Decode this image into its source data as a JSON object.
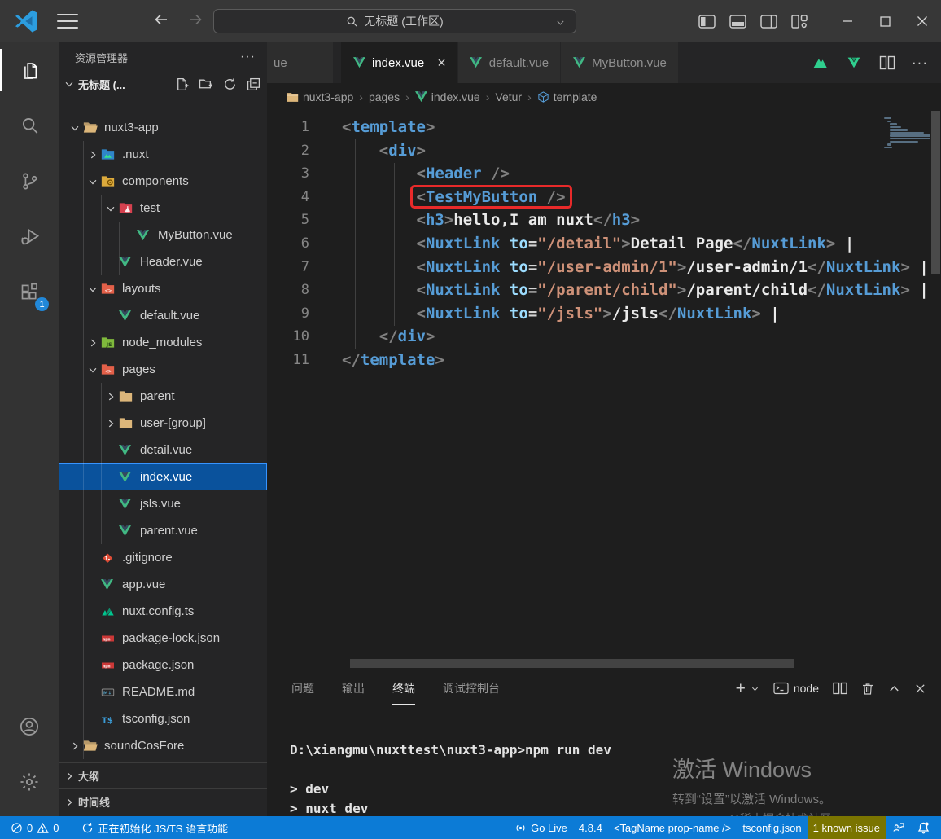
{
  "window": {
    "search_label": "无标题 (工作区)"
  },
  "activity_bar": {
    "extensions_badge": "1"
  },
  "sidebar": {
    "title": "资源管理器",
    "more_actions": "···",
    "section_label": "无标题 (...",
    "tree": [
      {
        "label": "nuxt3-app",
        "icon": "folder-open",
        "color": "#dcb67a",
        "level": 0,
        "chevron": "down"
      },
      {
        "label": ".nuxt",
        "icon": "folder-nuxt",
        "color": "#2f86c9",
        "level": 1,
        "chevron": "right"
      },
      {
        "label": "components",
        "icon": "folder-components",
        "color": "#dcaa3c",
        "level": 1,
        "chevron": "down"
      },
      {
        "label": "test",
        "icon": "folder-test",
        "color": "#d6414f",
        "level": 2,
        "chevron": "down"
      },
      {
        "label": "MyButton.vue",
        "icon": "vue",
        "level": 3
      },
      {
        "label": "Header.vue",
        "icon": "vue",
        "level": 2
      },
      {
        "label": "layouts",
        "icon": "folder-code",
        "color": "#e36049",
        "level": 1,
        "chevron": "down"
      },
      {
        "label": "default.vue",
        "icon": "vue",
        "level": 2
      },
      {
        "label": "node_modules",
        "icon": "folder-node",
        "color": "#7fb93c",
        "level": 1,
        "chevron": "right"
      },
      {
        "label": "pages",
        "icon": "folder-code",
        "color": "#e36049",
        "level": 1,
        "chevron": "down"
      },
      {
        "label": "parent",
        "icon": "folder",
        "color": "#dcb67a",
        "level": 2,
        "chevron": "right"
      },
      {
        "label": "user-[group]",
        "icon": "folder",
        "color": "#dcb67a",
        "level": 2,
        "chevron": "right"
      },
      {
        "label": "detail.vue",
        "icon": "vue",
        "level": 2
      },
      {
        "label": "index.vue",
        "icon": "vue",
        "level": 2,
        "selected": true
      },
      {
        "label": "jsls.vue",
        "icon": "vue",
        "level": 2
      },
      {
        "label": "parent.vue",
        "icon": "vue",
        "level": 2
      },
      {
        "label": ".gitignore",
        "icon": "git",
        "level": 1
      },
      {
        "label": "app.vue",
        "icon": "vue",
        "level": 1
      },
      {
        "label": "nuxt.config.ts",
        "icon": "nuxt",
        "level": 1
      },
      {
        "label": "package-lock.json",
        "icon": "npm",
        "level": 1
      },
      {
        "label": "package.json",
        "icon": "npm",
        "level": 1
      },
      {
        "label": "README.md",
        "icon": "md",
        "level": 1
      },
      {
        "label": "tsconfig.json",
        "icon": "ts",
        "level": 1
      },
      {
        "label": "soundCosFore",
        "icon": "folder-open",
        "color": "#dcb67a",
        "level": 0,
        "chevron": "right"
      }
    ],
    "bottom_sections": [
      {
        "label": "大纲"
      },
      {
        "label": "时间线"
      }
    ]
  },
  "editor": {
    "tabs": [
      {
        "label": "ue",
        "partial": true
      },
      {
        "label": "index.vue",
        "active": true
      },
      {
        "label": "default.vue"
      },
      {
        "label": "MyButton.vue"
      }
    ],
    "breadcrumb": [
      {
        "label": "nuxt3-app",
        "icon": "folder-sm"
      },
      {
        "label": "pages"
      },
      {
        "label": "index.vue",
        "icon": "vue"
      },
      {
        "label": "Vetur"
      },
      {
        "label": "template",
        "icon": "symbol"
      }
    ],
    "code_lines": [
      {
        "num": "1",
        "indent": 0,
        "segments": [
          {
            "t": "<",
            "c": "punct"
          },
          {
            "t": "template",
            "c": "tag"
          },
          {
            "t": ">",
            "c": "punct"
          }
        ]
      },
      {
        "num": "2",
        "indent": 1,
        "segments": [
          {
            "t": "<",
            "c": "punct"
          },
          {
            "t": "div",
            "c": "tag"
          },
          {
            "t": ">",
            "c": "punct"
          }
        ]
      },
      {
        "num": "3",
        "indent": 2,
        "segments": [
          {
            "t": "<",
            "c": "punct"
          },
          {
            "t": "Header",
            "c": "tag"
          },
          {
            "t": " />",
            "c": "punct"
          }
        ]
      },
      {
        "num": "4",
        "indent": 2,
        "boxed": true,
        "segments": [
          {
            "t": "<",
            "c": "punct"
          },
          {
            "t": "TestMyButton",
            "c": "tag"
          },
          {
            "t": " />",
            "c": "punct"
          }
        ]
      },
      {
        "num": "5",
        "indent": 2,
        "segments": [
          {
            "t": "<",
            "c": "punct"
          },
          {
            "t": "h3",
            "c": "tag"
          },
          {
            "t": ">",
            "c": "punct"
          },
          {
            "t": "hello,I am nuxt",
            "c": "text"
          },
          {
            "t": "</",
            "c": "punct"
          },
          {
            "t": "h3",
            "c": "tag"
          },
          {
            "t": ">",
            "c": "punct"
          }
        ]
      },
      {
        "num": "6",
        "indent": 2,
        "segments": [
          {
            "t": "<",
            "c": "punct"
          },
          {
            "t": "NuxtLink",
            "c": "tag"
          },
          {
            "t": " ",
            "c": "punct"
          },
          {
            "t": "to",
            "c": "attr"
          },
          {
            "t": "=",
            "c": "op"
          },
          {
            "t": "\"/detail\"",
            "c": "str"
          },
          {
            "t": ">",
            "c": "punct"
          },
          {
            "t": "Detail Page",
            "c": "text"
          },
          {
            "t": "</",
            "c": "punct"
          },
          {
            "t": "NuxtLink",
            "c": "tag"
          },
          {
            "t": ">",
            "c": "punct"
          },
          {
            "t": " |",
            "c": "text"
          }
        ]
      },
      {
        "num": "7",
        "indent": 2,
        "segments": [
          {
            "t": "<",
            "c": "punct"
          },
          {
            "t": "NuxtLink",
            "c": "tag"
          },
          {
            "t": " ",
            "c": "punct"
          },
          {
            "t": "to",
            "c": "attr"
          },
          {
            "t": "=",
            "c": "op"
          },
          {
            "t": "\"/user-admin/1\"",
            "c": "str"
          },
          {
            "t": ">",
            "c": "punct"
          },
          {
            "t": "/user-admin/1",
            "c": "text"
          },
          {
            "t": "</",
            "c": "punct"
          },
          {
            "t": "NuxtLink",
            "c": "tag"
          },
          {
            "t": ">",
            "c": "punct"
          },
          {
            "t": " |",
            "c": "text"
          }
        ]
      },
      {
        "num": "8",
        "indent": 2,
        "segments": [
          {
            "t": "<",
            "c": "punct"
          },
          {
            "t": "NuxtLink",
            "c": "tag"
          },
          {
            "t": " ",
            "c": "punct"
          },
          {
            "t": "to",
            "c": "attr"
          },
          {
            "t": "=",
            "c": "op"
          },
          {
            "t": "\"/parent/child\"",
            "c": "str"
          },
          {
            "t": ">",
            "c": "punct"
          },
          {
            "t": "/parent/child",
            "c": "text"
          },
          {
            "t": "</",
            "c": "punct"
          },
          {
            "t": "NuxtLink",
            "c": "tag"
          },
          {
            "t": ">",
            "c": "punct"
          },
          {
            "t": " |",
            "c": "text"
          }
        ]
      },
      {
        "num": "9",
        "indent": 2,
        "segments": [
          {
            "t": "<",
            "c": "punct"
          },
          {
            "t": "NuxtLink",
            "c": "tag"
          },
          {
            "t": " ",
            "c": "punct"
          },
          {
            "t": "to",
            "c": "attr"
          },
          {
            "t": "=",
            "c": "op"
          },
          {
            "t": "\"/jsls\"",
            "c": "str"
          },
          {
            "t": ">",
            "c": "punct"
          },
          {
            "t": "/jsls",
            "c": "text"
          },
          {
            "t": "</",
            "c": "punct"
          },
          {
            "t": "NuxtLink",
            "c": "tag"
          },
          {
            "t": ">",
            "c": "punct"
          },
          {
            "t": " |",
            "c": "text"
          }
        ]
      },
      {
        "num": "10",
        "indent": 1,
        "segments": [
          {
            "t": "</",
            "c": "punct"
          },
          {
            "t": "div",
            "c": "tag"
          },
          {
            "t": ">",
            "c": "punct"
          }
        ]
      },
      {
        "num": "11",
        "indent": 0,
        "segments": [
          {
            "t": "</",
            "c": "punct"
          },
          {
            "t": "template",
            "c": "tag"
          },
          {
            "t": ">",
            "c": "punct"
          }
        ]
      }
    ]
  },
  "panel": {
    "tabs": [
      {
        "label": "问题"
      },
      {
        "label": "输出"
      },
      {
        "label": "终端",
        "active": true
      },
      {
        "label": "调试控制台"
      }
    ],
    "shell_label": "node",
    "terminal_lines": [
      "D:\\xiangmu\\nuxttest\\nuxt3-app>npm run dev",
      "",
      "> dev",
      "> nuxt dev"
    ],
    "watermark": {
      "line1": "激活 Windows",
      "line2": "转到“设置”以激活 Windows。",
      "line3": "@稀土掘金技术社区"
    }
  },
  "status_bar": {
    "errors": "0",
    "warnings": "0",
    "initializing": "正在初始化 JS/TS 语言功能",
    "go_live": "Go Live",
    "version": "4.8.4",
    "tag_hint": "<TagName prop-name />",
    "tsconfig": "tsconfig.json",
    "known_issue": "1 known issue"
  }
}
